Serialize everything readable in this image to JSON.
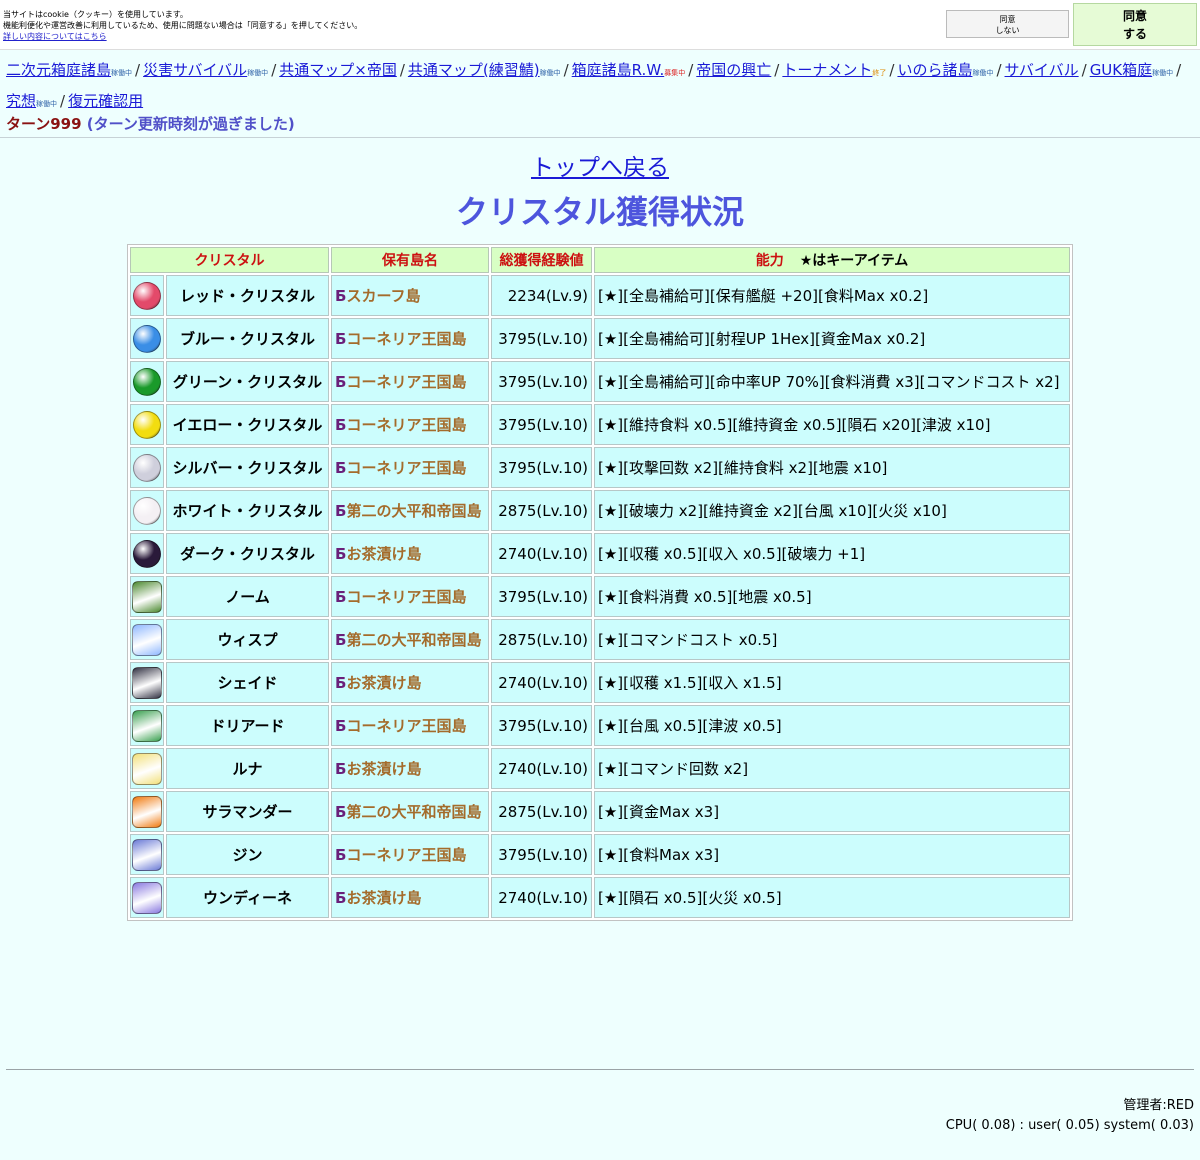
{
  "cookie": {
    "lines": [
      "当サイトはcookie（クッキー）を使用しています。",
      "機能利便化や運営改善に利用しているため、使用に問題ない場合は「同意する」を押してください。"
    ],
    "link_text": "詳しい内容についてはこちら",
    "disagree_line1": "同意",
    "disagree_line2": "しない",
    "agree_line1": "同意",
    "agree_line2": "する"
  },
  "game_links": [
    {
      "label": "二次元箱庭諸島",
      "status": "稼働中",
      "status_type": "running"
    },
    {
      "label": "災害サバイバル",
      "status": "稼働中",
      "status_type": "running"
    },
    {
      "label": "共通マップ×帝国",
      "status": "",
      "status_type": ""
    },
    {
      "label": "共通マップ(練習鯖)",
      "status": "稼働中",
      "status_type": "running"
    },
    {
      "label": "箱庭諸島R.W.",
      "status": "募集中",
      "status_type": "recruit"
    },
    {
      "label": "帝国の興亡",
      "status": "",
      "status_type": ""
    },
    {
      "label": "トーナメント",
      "status": "終了",
      "status_type": "ended"
    },
    {
      "label": "いのら諸島",
      "status": "稼働中",
      "status_type": "running"
    },
    {
      "label": "サバイバル",
      "status": "",
      "status_type": ""
    },
    {
      "label": "GUK箱庭",
      "status": "稼働中",
      "status_type": "running"
    },
    {
      "label": "究想",
      "status": "稼働中",
      "status_type": "running"
    },
    {
      "label": "復元確認用",
      "status": "",
      "status_type": ""
    }
  ],
  "separator": "/",
  "turn": {
    "label": "ターン999",
    "note": "(ターン更新時刻が過ぎました)"
  },
  "back_to_top": "トップへ戻る",
  "page_title": "クリスタル獲得状況",
  "table": {
    "headers": {
      "crystal": "クリスタル",
      "island": "保有島名",
      "exp": "総獲得経験値",
      "ability": "能力",
      "key_note": "★はキーアイテム"
    },
    "rows": [
      {
        "icon": "red-crystal-icon",
        "color": "#e34a6a",
        "name": "レッド・クリスタル",
        "island_prefix": "Б",
        "island": "スカーフ島",
        "exp": "2234(Lv.9)",
        "ability": "[★][全島補給可][保有艦艇 +20][食料Max x0.2]"
      },
      {
        "icon": "blue-crystal-icon",
        "color": "#3a8ee6",
        "name": "ブルー・クリスタル",
        "island_prefix": "Б",
        "island": "コーネリア王国島",
        "exp": "3795(Lv.10)",
        "ability": "[★][全島補給可][射程UP 1Hex][資金Max x0.2]"
      },
      {
        "icon": "green-crystal-icon",
        "color": "#1a9a2a",
        "name": "グリーン・クリスタル",
        "island_prefix": "Б",
        "island": "コーネリア王国島",
        "exp": "3795(Lv.10)",
        "ability": "[★][全島補給可][命中率UP 70%][食料消費 x3][コマンドコスト x2]"
      },
      {
        "icon": "yellow-crystal-icon",
        "color": "#f2dd10",
        "name": "イエロー・クリスタル",
        "island_prefix": "Б",
        "island": "コーネリア王国島",
        "exp": "3795(Lv.10)",
        "ability": "[★][維持食料 x0.5][維持資金 x0.5][隕石 x20][津波 x10]"
      },
      {
        "icon": "silver-crystal-icon",
        "color": "#cfcfdc",
        "name": "シルバー・クリスタル",
        "island_prefix": "Б",
        "island": "コーネリア王国島",
        "exp": "3795(Lv.10)",
        "ability": "[★][攻撃回数 x2][維持食料 x2][地震 x10]"
      },
      {
        "icon": "white-crystal-icon",
        "color": "#f4f0f4",
        "name": "ホワイト・クリスタル",
        "island_prefix": "Б",
        "island": "第二の大平和帝国島",
        "exp": "2875(Lv.10)",
        "ability": "[★][破壊力 x2][維持資金 x2][台風 x10][火災 x10]"
      },
      {
        "icon": "dark-crystal-icon",
        "color": "#2a1a3a",
        "name": "ダーク・クリスタル",
        "island_prefix": "Б",
        "island": "お茶漬け島",
        "exp": "2740(Lv.10)",
        "ability": "[★][収穫 x0.5][収入 x0.5][破壊力 +1]"
      },
      {
        "icon": "gnome-icon",
        "color": "#4c8a30",
        "name": "ノーム",
        "island_prefix": "Б",
        "island": "コーネリア王国島",
        "exp": "3795(Lv.10)",
        "ability": "[★][食料消費 x0.5][地震 x0.5]"
      },
      {
        "icon": "wisp-icon",
        "color": "#8fb8ff",
        "name": "ウィスプ",
        "island_prefix": "Б",
        "island": "第二の大平和帝国島",
        "exp": "2875(Lv.10)",
        "ability": "[★][コマンドコスト x0.5]"
      },
      {
        "icon": "shade-icon",
        "color": "#333344",
        "name": "シェイド",
        "island_prefix": "Б",
        "island": "お茶漬け島",
        "exp": "2740(Lv.10)",
        "ability": "[★][収穫 x1.5][収入 x1.5]"
      },
      {
        "icon": "dryad-icon",
        "color": "#3aa050",
        "name": "ドリアード",
        "island_prefix": "Б",
        "island": "コーネリア王国島",
        "exp": "3795(Lv.10)",
        "ability": "[★][台風 x0.5][津波 x0.5]"
      },
      {
        "icon": "luna-icon",
        "color": "#f2e07a",
        "name": "ルナ",
        "island_prefix": "Б",
        "island": "お茶漬け島",
        "exp": "2740(Lv.10)",
        "ability": "[★][コマンド回数 x2]"
      },
      {
        "icon": "salamander-icon",
        "color": "#f07a10",
        "name": "サラマンダー",
        "island_prefix": "Б",
        "island": "第二の大平和帝国島",
        "exp": "2875(Lv.10)",
        "ability": "[★][資金Max x3]"
      },
      {
        "icon": "jinn-icon",
        "color": "#6a7ad6",
        "name": "ジン",
        "island_prefix": "Б",
        "island": "コーネリア王国島",
        "exp": "3795(Lv.10)",
        "ability": "[★][食料Max x3]"
      },
      {
        "icon": "undine-icon",
        "color": "#8a7ae0",
        "name": "ウンディーネ",
        "island_prefix": "Б",
        "island": "お茶漬け島",
        "exp": "2740(Lv.10)",
        "ability": "[★][隕石 x0.5][火災 x0.5]"
      }
    ]
  },
  "footer": {
    "admin": "管理者:RED",
    "cpu": "CPU( 0.08) : user( 0.05) system( 0.03)"
  }
}
